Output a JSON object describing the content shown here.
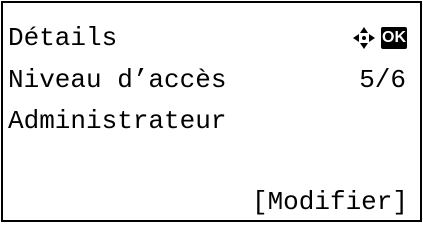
{
  "screen": {
    "title": "Détails",
    "setting_label": "Niveau d’accès",
    "page_indicator": "5/6",
    "setting_value": "Administrateur",
    "action_label": "[Modifier]",
    "ok_label": "OK"
  },
  "icons": {
    "navigation": "four-way-arrows-icon",
    "confirm": "ok-key-icon"
  }
}
